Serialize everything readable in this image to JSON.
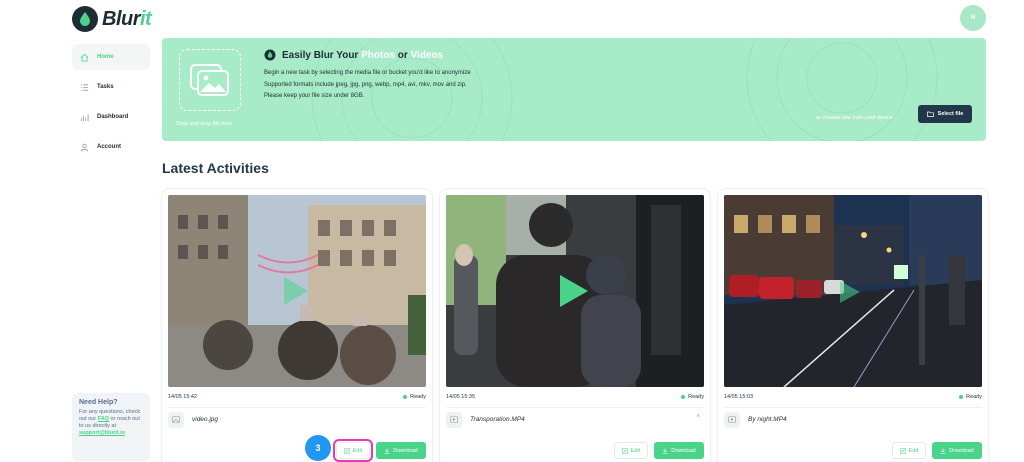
{
  "brand": {
    "name_prefix": "Blur",
    "name_suffix": "it",
    "accent": "#4ad38a",
    "dark": "#1f2d33"
  },
  "user": {
    "initials": "N"
  },
  "sidebar": {
    "items": [
      {
        "label": "Home",
        "icon": "home-icon",
        "active": true
      },
      {
        "label": "Tasks",
        "icon": "list-icon",
        "active": false
      },
      {
        "label": "Dashboard",
        "icon": "chart-icon",
        "active": false
      },
      {
        "label": "Account",
        "icon": "user-icon",
        "active": false
      }
    ],
    "help": {
      "title": "Need Help?",
      "text_1": "For any questions, check out our ",
      "faq": "FAQ",
      "text_2": " or reach out to us directly at",
      "email": "support@blurit.io"
    }
  },
  "banner": {
    "title_1": "Easily Blur Your ",
    "title_photos": "Photos",
    "title_or": " or ",
    "title_videos": "Videos",
    "line_1": "Begin a new task by selecting the media file or bucket you'd like to anonymize",
    "line_2": "Supported formats include jpeg, jpg, png, webp, mp4, avi, mkv, mov and zip.",
    "line_3": "Please keep your file size under 8GB.",
    "drop_hint": "Drag and drop file here",
    "device_hint": "or choose one from your device",
    "select_label": "Select file",
    "bg_color": "#a7ebc8"
  },
  "activities": {
    "title": "Latest Activities",
    "cards": [
      {
        "timestamp": "14/05 15:42",
        "status": "Ready",
        "file_name": "video.jpg",
        "edit_label": "Edit",
        "download_label": "Download",
        "expandable": false
      },
      {
        "timestamp": "14/05 15:35",
        "status": "Ready",
        "file_name": "Transporation.MP4",
        "edit_label": "Edit",
        "download_label": "Download",
        "expandable": true
      },
      {
        "timestamp": "14/05 15:03",
        "status": "Ready",
        "file_name": "By night.MP4",
        "edit_label": "Edit",
        "download_label": "Download",
        "expandable": false
      }
    ]
  },
  "tutorial": {
    "step": "3",
    "highlight_color": "#e838b4",
    "badge_color": "#2196f3"
  }
}
